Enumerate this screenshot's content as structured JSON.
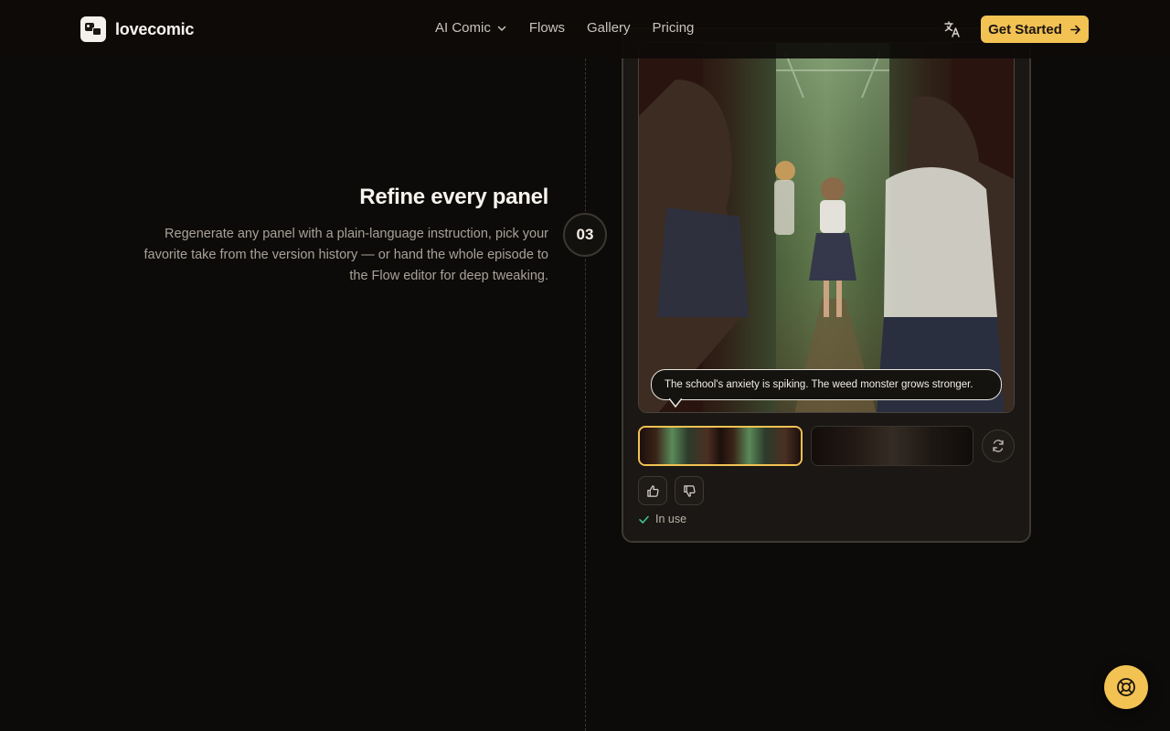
{
  "header": {
    "brand": "lovecomic",
    "nav": [
      {
        "label": "AI Comic",
        "has_dropdown": true
      },
      {
        "label": "Flows"
      },
      {
        "label": "Gallery"
      },
      {
        "label": "Pricing"
      }
    ],
    "cta_label": "Get Started"
  },
  "step": {
    "number": "03",
    "title": "Refine every panel",
    "description": "Regenerate any panel with a plain-language instruction, pick your favorite take from the version history — or hand the whole episode to the Flow editor for deep tweaking."
  },
  "card": {
    "caption": "The school's anxiety is spiking. The weed monster grows stronger.",
    "status": "In use"
  },
  "colors": {
    "accent": "#f2c253",
    "background": "#0d0b09",
    "success": "#3cc58a"
  },
  "icons": [
    "translate-icon",
    "arrow-right-icon",
    "chevron-down-icon",
    "refresh-icon",
    "thumbs-up-icon",
    "thumbs-down-icon",
    "check-icon",
    "lifebuoy-icon"
  ]
}
